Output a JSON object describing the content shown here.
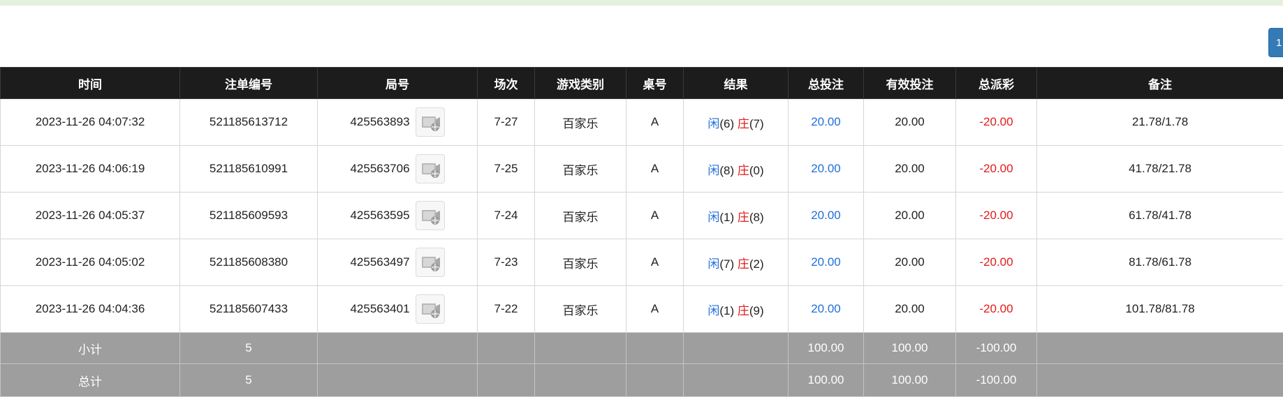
{
  "pager": {
    "current_page": "1"
  },
  "table": {
    "headers": [
      "时间",
      "注单编号",
      "局号",
      "场次",
      "游戏类别",
      "桌号",
      "结果",
      "总投注",
      "有效投注",
      "总派彩",
      "备注"
    ],
    "rows": [
      {
        "time": "2023-11-26 04:07:32",
        "bet_id": "521185613712",
        "round": "425563893",
        "session": "7-27",
        "game": "百家乐",
        "table": "A",
        "player_label": "闲",
        "player_score": "(6)",
        "banker_label": "庄",
        "banker_score": "(7)",
        "total_bet": "20.00",
        "valid_bet": "20.00",
        "payout": "-20.00",
        "note": "21.78/1.78"
      },
      {
        "time": "2023-11-26 04:06:19",
        "bet_id": "521185610991",
        "round": "425563706",
        "session": "7-25",
        "game": "百家乐",
        "table": "A",
        "player_label": "闲",
        "player_score": "(8)",
        "banker_label": "庄",
        "banker_score": "(0)",
        "total_bet": "20.00",
        "valid_bet": "20.00",
        "payout": "-20.00",
        "note": "41.78/21.78"
      },
      {
        "time": "2023-11-26 04:05:37",
        "bet_id": "521185609593",
        "round": "425563595",
        "session": "7-24",
        "game": "百家乐",
        "table": "A",
        "player_label": "闲",
        "player_score": "(1)",
        "banker_label": "庄",
        "banker_score": "(8)",
        "total_bet": "20.00",
        "valid_bet": "20.00",
        "payout": "-20.00",
        "note": "61.78/41.78"
      },
      {
        "time": "2023-11-26 04:05:02",
        "bet_id": "521185608380",
        "round": "425563497",
        "session": "7-23",
        "game": "百家乐",
        "table": "A",
        "player_label": "闲",
        "player_score": "(7)",
        "banker_label": "庄",
        "banker_score": "(2)",
        "total_bet": "20.00",
        "valid_bet": "20.00",
        "payout": "-20.00",
        "note": "81.78/61.78"
      },
      {
        "time": "2023-11-26 04:04:36",
        "bet_id": "521185607433",
        "round": "425563401",
        "session": "7-22",
        "game": "百家乐",
        "table": "A",
        "player_label": "闲",
        "player_score": "(1)",
        "banker_label": "庄",
        "banker_score": "(9)",
        "total_bet": "20.00",
        "valid_bet": "20.00",
        "payout": "-20.00",
        "note": "101.78/81.78"
      }
    ],
    "subtotal": {
      "label": "小计",
      "count": "5",
      "total_bet": "100.00",
      "valid_bet": "100.00",
      "payout": "-100.00"
    },
    "grand_total": {
      "label": "总计",
      "count": "5",
      "total_bet": "100.00",
      "valid_bet": "100.00",
      "payout": "-100.00"
    }
  },
  "icons": {
    "video": "video-replay-icon"
  },
  "colors": {
    "header_bg": "#1c1c1c",
    "summary_bg": "#9e9e9e",
    "blue_text": "#1f6fd8",
    "red_text": "#e21b1b",
    "pager_bg": "#337ab7",
    "top_strip": "#e3f1dd"
  }
}
